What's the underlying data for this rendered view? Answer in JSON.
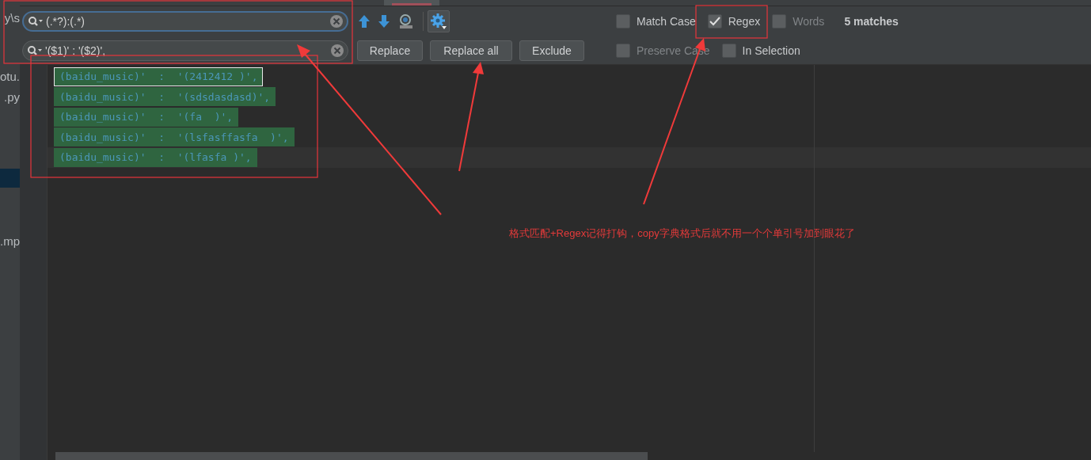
{
  "sidebar": {
    "items": [
      {
        "label": "y\\s"
      },
      {
        "label": "otu."
      },
      {
        "label": ".py"
      },
      {
        "label": ".mp"
      }
    ]
  },
  "find_bar": {
    "search": {
      "value": "(.*?):(.*)"
    },
    "replace": {
      "value": "'($1)' : '($2)',"
    },
    "buttons": [
      "Replace",
      "Replace all",
      "Exclude"
    ],
    "options_top": [
      {
        "label": "Match Case",
        "checked": false,
        "disabled": false
      },
      {
        "label": "Regex",
        "checked": true,
        "disabled": false
      },
      {
        "label": "Words",
        "checked": false,
        "disabled": true
      }
    ],
    "match_count": "5 matches",
    "options_bottom": [
      {
        "label": "Preserve Case",
        "checked": false,
        "disabled": true
      },
      {
        "label": "In Selection",
        "checked": false,
        "disabled": false
      }
    ]
  },
  "editor": {
    "lines": [
      {
        "text": "(baidu_music)'  :  '(2412412 )',",
        "selected": true,
        "caret_line": false
      },
      {
        "text": "(baidu_music)'  :  '(sdsdasdasd)',",
        "selected": false,
        "caret_line": false
      },
      {
        "text": "(baidu_music)'  :  '(fa  )',",
        "selected": false,
        "caret_line": false
      },
      {
        "text": "(baidu_music)'  :  '(lsfasffasfa  )',",
        "selected": false,
        "caret_line": false
      },
      {
        "text": "(baidu_music)'  :  '(lfasfa )',",
        "selected": false,
        "caret_line": true
      }
    ]
  },
  "annotation": {
    "text": "格式匹配+Regex记得打钩，copy字典格式后就不用一个个单引号加到眼花了"
  }
}
